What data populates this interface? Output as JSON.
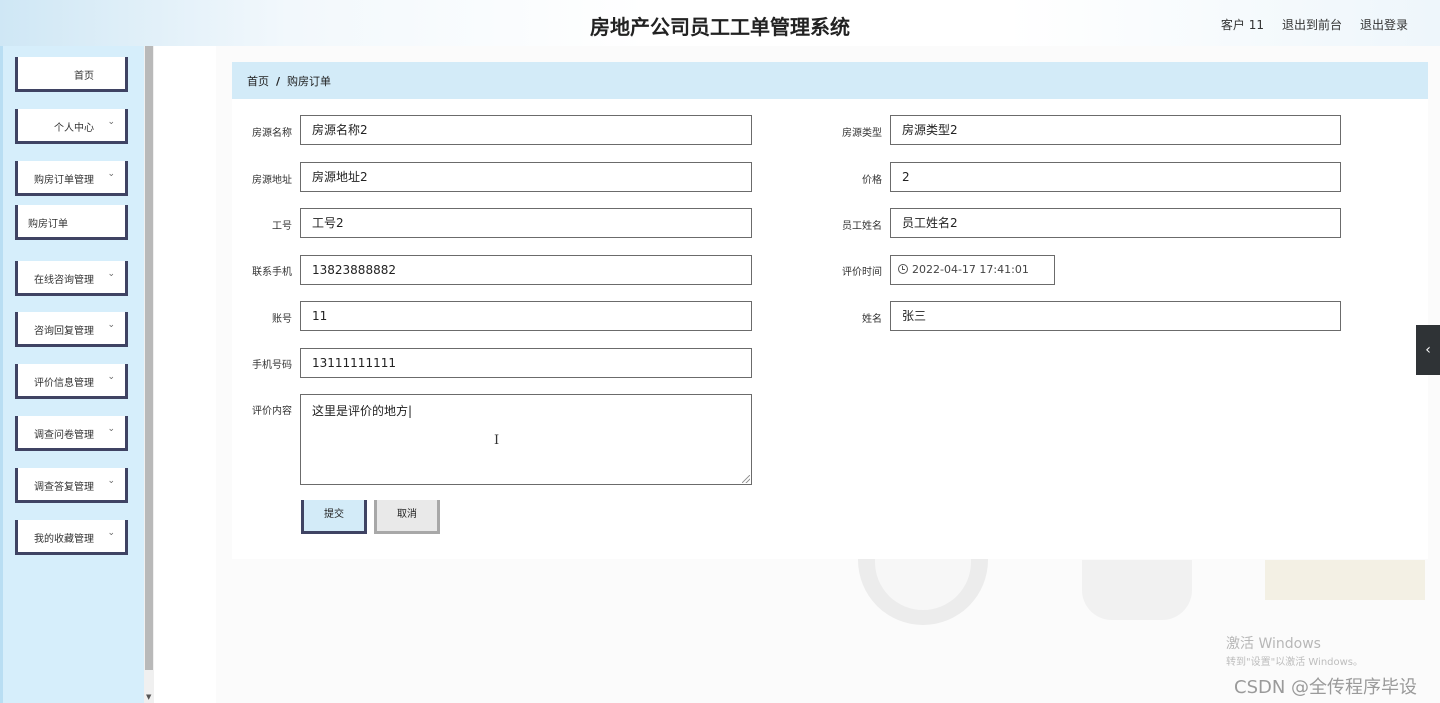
{
  "header": {
    "title": "房地产公司员工工单管理系统",
    "user": "客户 11",
    "front_link": "退出到前台",
    "logout_link": "退出登录"
  },
  "sidebar": {
    "items": [
      {
        "label": "首页",
        "has_chevron": false
      },
      {
        "label": "个人中心",
        "has_chevron": true
      },
      {
        "label": "购房订单管理",
        "has_chevron": true
      },
      {
        "label": "购房订单",
        "has_chevron": false,
        "sub": true
      },
      {
        "label": "在线咨询管理",
        "has_chevron": true
      },
      {
        "label": "咨询回复管理",
        "has_chevron": true
      },
      {
        "label": "评价信息管理",
        "has_chevron": true
      },
      {
        "label": "调查问卷管理",
        "has_chevron": true
      },
      {
        "label": "调查答复管理",
        "has_chevron": true
      },
      {
        "label": "我的收藏管理",
        "has_chevron": true
      }
    ],
    "chevron_glyph": "⌄"
  },
  "breadcrumb": {
    "home": "首页",
    "separator": "/",
    "current": "购房订单"
  },
  "form": {
    "house_name": {
      "label": "房源名称",
      "value": "房源名称2"
    },
    "house_type": {
      "label": "房源类型",
      "value": "房源类型2"
    },
    "house_address": {
      "label": "房源地址",
      "value": "房源地址2"
    },
    "price": {
      "label": "价格",
      "value": "2"
    },
    "employee_no": {
      "label": "工号",
      "value": "工号2"
    },
    "employee_name": {
      "label": "员工姓名",
      "value": "员工姓名2"
    },
    "contact_phone": {
      "label": "联系手机",
      "value": "13823888882"
    },
    "review_time": {
      "label": "评价时间",
      "value": "2022-04-17 17:41:01"
    },
    "account": {
      "label": "账号",
      "value": "11"
    },
    "name": {
      "label": "姓名",
      "value": "张三"
    },
    "mobile": {
      "label": "手机号码",
      "value": "13111111111"
    },
    "review_content": {
      "label": "评价内容",
      "value": "这里是评价的地方|"
    }
  },
  "buttons": {
    "submit": "提交",
    "cancel": "取消"
  },
  "side_tab_glyph": "‹",
  "watermark": {
    "line1": "激活 Windows",
    "line2": "转到\"设置\"以激活 Windows。",
    "line3": "CSDN @全传程序毕设"
  },
  "colors": {
    "accent_dark": "#3f4363",
    "sidebar_bg": "#d6eefb",
    "breadcrumb_bg": "#d3ebf8"
  }
}
